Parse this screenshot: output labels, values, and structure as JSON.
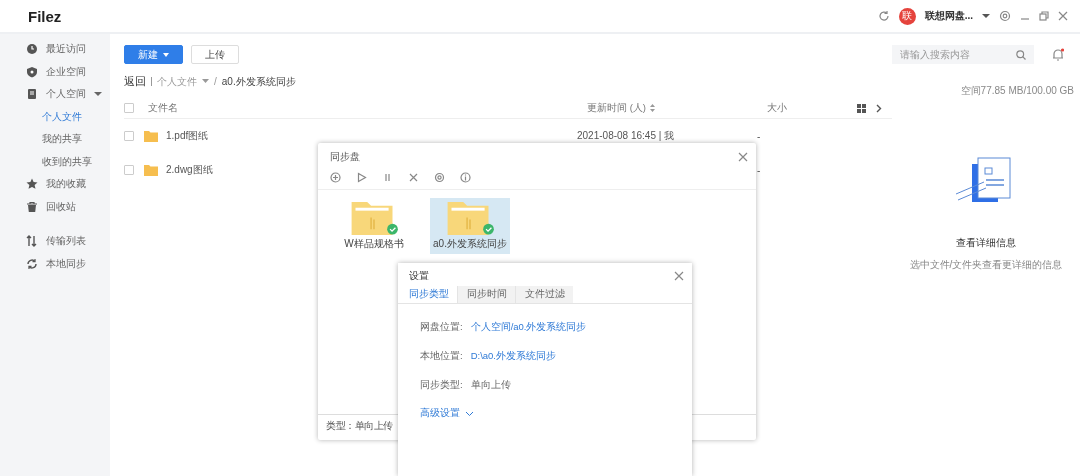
{
  "app": {
    "logo": "Filez"
  },
  "header": {
    "avatar": "联",
    "user_name": "联想网盘...",
    "notifications_unread": true
  },
  "sidebar": {
    "groups": [
      [
        {
          "label": "最近访问",
          "selected": false
        },
        {
          "label": "企业空间",
          "selected": false
        },
        {
          "label": "个人空间",
          "selected": false,
          "expanded": true,
          "children": [
            {
              "label": "个人文件",
              "selected": true
            },
            {
              "label": "我的共享",
              "selected": false
            },
            {
              "label": "收到的共享",
              "selected": false
            }
          ]
        },
        {
          "label": "我的收藏",
          "selected": false
        },
        {
          "label": "回收站",
          "selected": false
        }
      ],
      [
        {
          "label": "传输列表",
          "selected": false
        },
        {
          "label": "本地同步",
          "selected": false
        }
      ]
    ]
  },
  "toolbar": {
    "buttons": [
      {
        "label": "新建",
        "kind": "primary"
      },
      {
        "label": "上传",
        "kind": "default"
      }
    ],
    "search": {
      "placeholder": "请输入搜索内容"
    }
  },
  "breadcrumb": {
    "back": "返回",
    "separator": "/",
    "items": [
      "个人文件",
      "a0.外发系统同步"
    ]
  },
  "table": {
    "all_checked": false,
    "columns": [
      "文件名",
      "更新时间 (人)",
      "大小"
    ],
    "rows": [
      {
        "name": "1.pdf图纸",
        "checked": false,
        "updated": "2021-08-08 16:45 | 我",
        "size": "-"
      },
      {
        "name": "2.dwg图纸",
        "checked": false,
        "size": "-"
      }
    ]
  },
  "detail": {
    "storage": "空间77.85 MB/100.00 GB",
    "title": "查看详细信息",
    "description": "选中文件/文件夹查看更详细的信息"
  },
  "sync_dialog": {
    "title": "同步盘",
    "folders": [
      {
        "name": "W样品规格书",
        "selected": false,
        "synced": true
      },
      {
        "name": "a0.外发系统同步",
        "selected": true,
        "synced": true
      }
    ],
    "footer": "类型：单向上传"
  },
  "settings_dialog": {
    "title": "设置",
    "tabs": [
      {
        "label": "同步类型",
        "selected": true
      },
      {
        "label": "同步时间",
        "selected": false
      },
      {
        "label": "文件过滤",
        "selected": false
      }
    ],
    "fields": [
      {
        "label": "网盘位置:",
        "value": "个人空间/a0.外发系统同步",
        "kind": "link"
      },
      {
        "label": "本地位置:",
        "value": "D:\\a0.外发系统同步",
        "kind": "link"
      },
      {
        "label": "同步类型:",
        "value": "单向上传",
        "kind": "text"
      }
    ],
    "advanced": {
      "label": "高级设置",
      "expanded": false
    }
  }
}
